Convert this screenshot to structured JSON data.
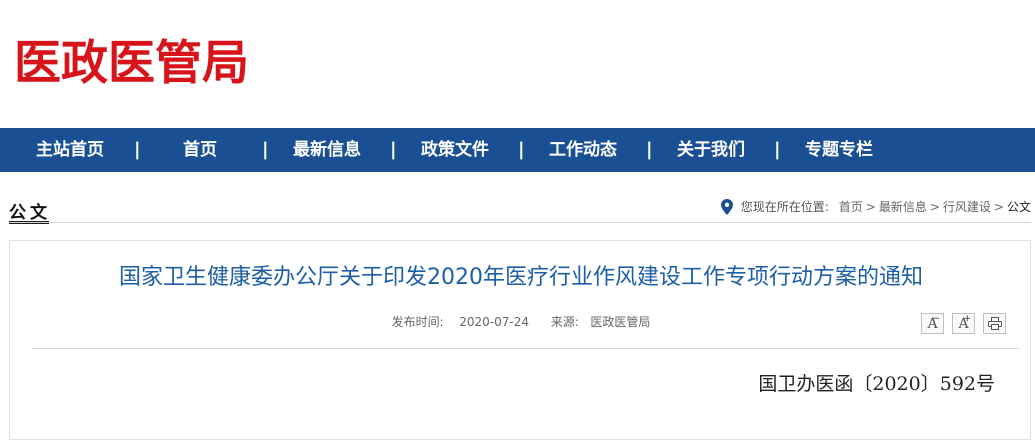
{
  "site": {
    "logo_text": "医政医管局",
    "colors": {
      "logo": "#d8141b",
      "nav_bg": "#1a4f93",
      "title": "#1d5ea8"
    }
  },
  "nav": {
    "items": [
      {
        "label": "主站首页"
      },
      {
        "label": "首页"
      },
      {
        "label": "最新信息"
      },
      {
        "label": "政策文件"
      },
      {
        "label": "工作动态"
      },
      {
        "label": "关于我们"
      },
      {
        "label": "专题专栏"
      }
    ],
    "separator": "|"
  },
  "section": {
    "title": "公文"
  },
  "breadcrumb": {
    "icon": "location-pin-icon",
    "prefix": "您现在所在位置:",
    "items": [
      "首页",
      "最新信息",
      "行风建设"
    ],
    "current": "公文",
    "separator": ">"
  },
  "article": {
    "title": "国家卫生健康委办公厅关于印发2020年医疗行业作风建设工作专项行动方案的通知",
    "publish_label": "发布时间:",
    "publish_date": "2020-07-24",
    "source_label": "来源:",
    "source": "医政医管局",
    "doc_number": "国卫办医函〔2020〕592号"
  },
  "tools": {
    "font_decrease": {
      "glyph": "A",
      "mark": "−",
      "icon": "font-decrease-icon"
    },
    "font_increase": {
      "glyph": "A",
      "mark": "+",
      "icon": "font-increase-icon"
    },
    "print": {
      "icon": "printer-icon"
    }
  }
}
